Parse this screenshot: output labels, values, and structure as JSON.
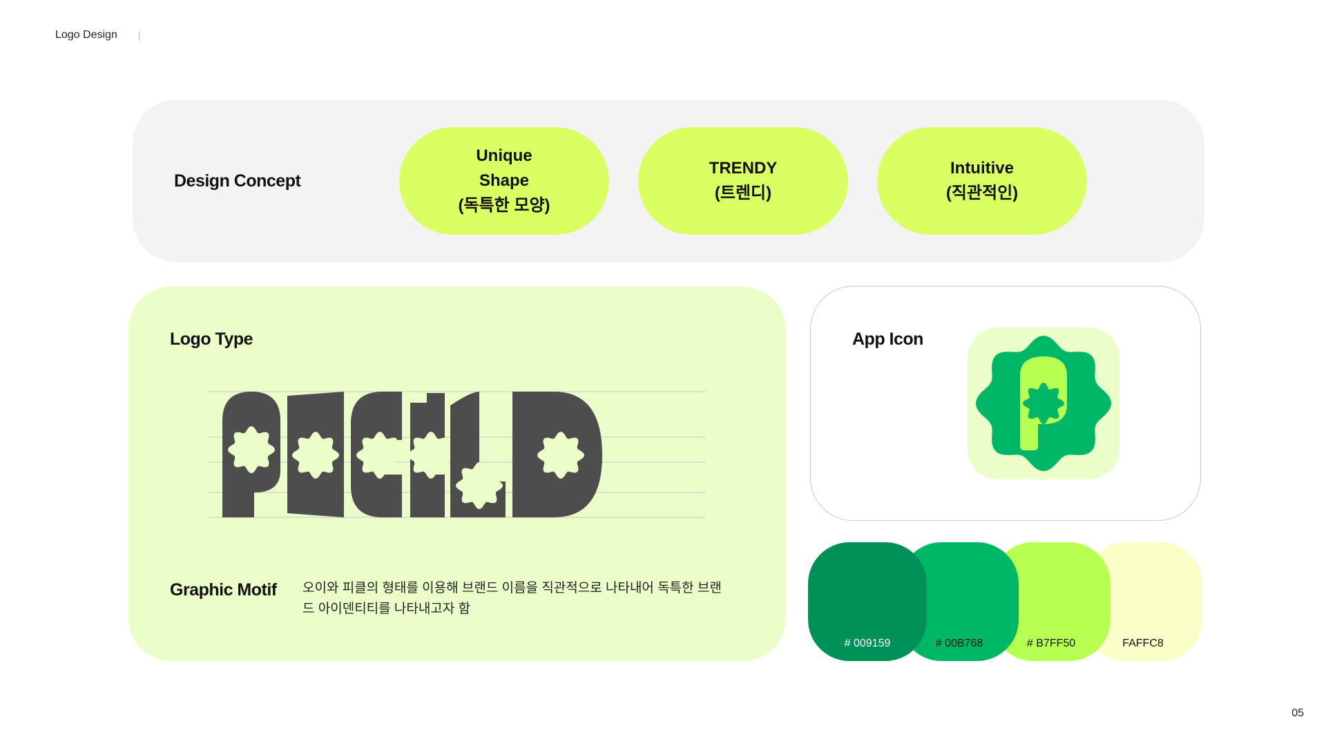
{
  "header": {
    "title": "Logo Design"
  },
  "page_number": "05",
  "concept": {
    "label": "Design Concept",
    "pills": [
      {
        "text": "Unique\nShape\n(독특한 모양)"
      },
      {
        "text": "TRENDY\n(트렌디)"
      },
      {
        "text": "Intuitive\n(직관적인)"
      }
    ]
  },
  "logo_type": {
    "label": "Logo Type",
    "wordmark": "PICKLE",
    "letter_color": "#4d4d4d"
  },
  "motif": {
    "label": "Graphic Motif",
    "description": "오이와 피클의 형태를 이용해 브랜드 이름을 직관적으로 나타내어 독특한 브랜드 아이덴티티를 나타내고자 함"
  },
  "app_icon": {
    "label": "App Icon",
    "colors": {
      "background": "#ebfdc8",
      "badge": "#00b768",
      "letter": "#b7ff50",
      "center": "#00b768"
    }
  },
  "palette": [
    {
      "label": "# 009159",
      "hex": "#009159"
    },
    {
      "label": "# 00B768",
      "hex": "#00B768"
    },
    {
      "label": "# B7FF50",
      "hex": "#B7FF50"
    },
    {
      "label": "FAFFC8",
      "hex": "#FAFFC8"
    }
  ]
}
